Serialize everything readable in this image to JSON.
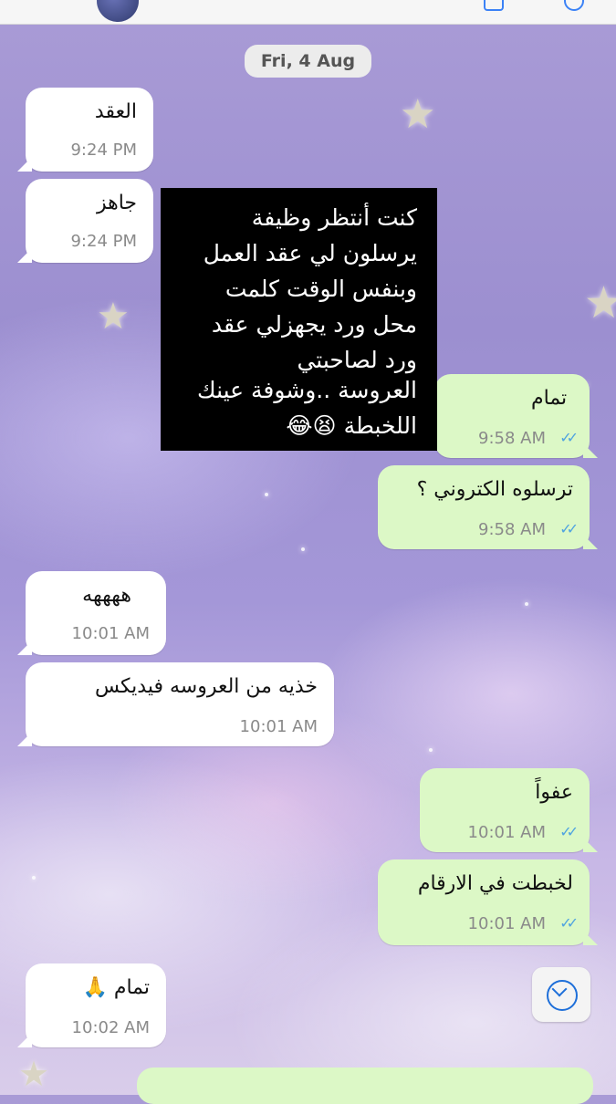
{
  "date_separator": "Fri, 4 Aug",
  "messages": [
    {
      "dir": "in",
      "text": "العقد",
      "time": "9:24 PM"
    },
    {
      "dir": "in",
      "text": "جاهز",
      "time": "9:24 PM"
    },
    {
      "dir": "out",
      "text": "تمام",
      "time": "9:58 AM",
      "status": "read"
    },
    {
      "dir": "out",
      "text": "ترسلوه الكتروني ؟",
      "time": "9:58 AM",
      "status": "read"
    },
    {
      "dir": "in",
      "text": "ههههه",
      "time": "10:01 AM"
    },
    {
      "dir": "in",
      "text": "خذيه من العروسه فيديكس",
      "time": "10:01 AM"
    },
    {
      "dir": "out",
      "text": "عفواً",
      "time": "10:01 AM",
      "status": "read"
    },
    {
      "dir": "out",
      "text": "لخبطت في الارقام",
      "time": "10:01 AM",
      "status": "read"
    },
    {
      "dir": "in",
      "text": "تمام 🙏",
      "time": "10:02 AM"
    }
  ],
  "overlay_caption": {
    "lines": [
      "كنت أنتظر وظيفة",
      "يرسلون لي عقد العمل",
      "وبنفس الوقت كلمت",
      "محل ورد يجهزلي عقد",
      "ورد لصاحبتي",
      "العروسة ..وشوفة عينك",
      "اللخبطة 😫😂"
    ]
  },
  "icons": {
    "read_ticks": "double-check-icon",
    "scroll_down": "chevron-down-circle-icon"
  },
  "colors": {
    "incoming_bubble": "#ffffff",
    "outgoing_bubble": "#dcf8c6",
    "read_tick": "#4fa3e0",
    "overlay_bg": "#000000"
  }
}
